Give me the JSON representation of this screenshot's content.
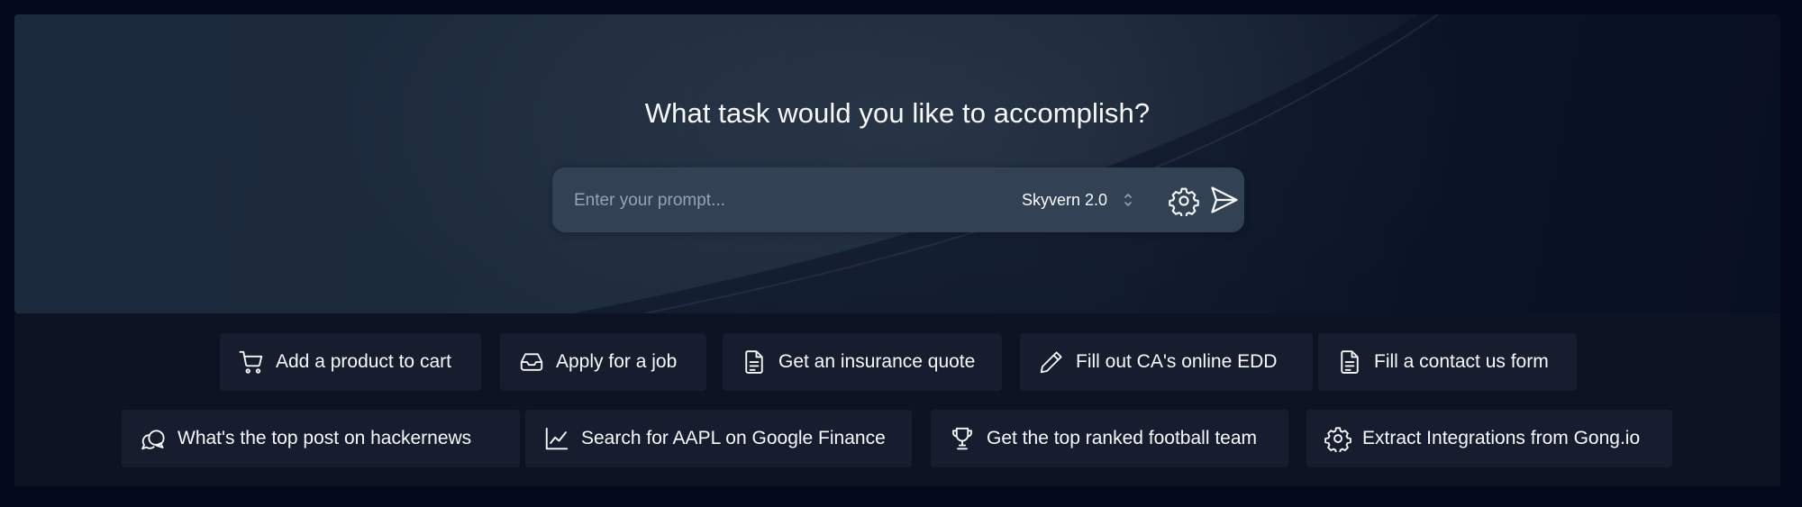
{
  "hero": {
    "headline": "What task would you like to accomplish?"
  },
  "prompt": {
    "placeholder": "Enter your prompt...",
    "value": "",
    "model": "Skyvern 2.0"
  },
  "suggestions": {
    "row1": [
      {
        "label": "Add a product to cart",
        "icon": "cart-icon"
      },
      {
        "label": "Apply for a job",
        "icon": "inbox-icon"
      },
      {
        "label": "Get an insurance quote",
        "icon": "document-icon"
      },
      {
        "label": "Fill out CA's online EDD",
        "icon": "pencil-icon"
      },
      {
        "label": "Fill a contact us form",
        "icon": "document-icon"
      }
    ],
    "row2": [
      {
        "label": "What's the top post on hackernews",
        "icon": "chat-bubbles-icon"
      },
      {
        "label": "Search for AAPL on Google Finance",
        "icon": "line-chart-icon"
      },
      {
        "label": "Get the top ranked football team",
        "icon": "trophy-icon"
      },
      {
        "label": "Extract Integrations from Gong.io",
        "icon": "gear-icon"
      }
    ]
  },
  "colors": {
    "background": "#040a1c",
    "hero": "#1d2b3c",
    "prompt_bar": "#334155",
    "chip": "#151d2e",
    "text": "#f8fafc",
    "placeholder": "#94a3b8"
  }
}
